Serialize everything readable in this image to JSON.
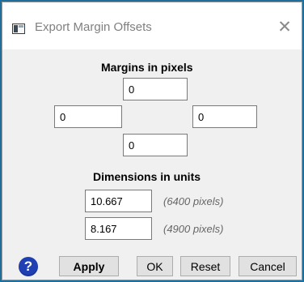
{
  "dialog": {
    "title": "Export Margin Offsets",
    "close_symbol": "✕",
    "icons": {
      "app": "app-window-icon",
      "close": "close-icon",
      "help": "help-icon"
    },
    "accent_color": "#1f3fb2"
  },
  "margins": {
    "heading": "Margins in pixels",
    "top": "0",
    "left": "0",
    "right": "0",
    "bottom": "0"
  },
  "dimensions": {
    "heading": "Dimensions in units",
    "width_value": "10.667",
    "width_hint": "(6400 pixels)",
    "height_value": "8.167",
    "height_hint": "(4900 pixels)"
  },
  "buttons": {
    "help_symbol": "?",
    "apply": "Apply",
    "ok": "OK",
    "reset": "Reset",
    "cancel": "Cancel"
  }
}
